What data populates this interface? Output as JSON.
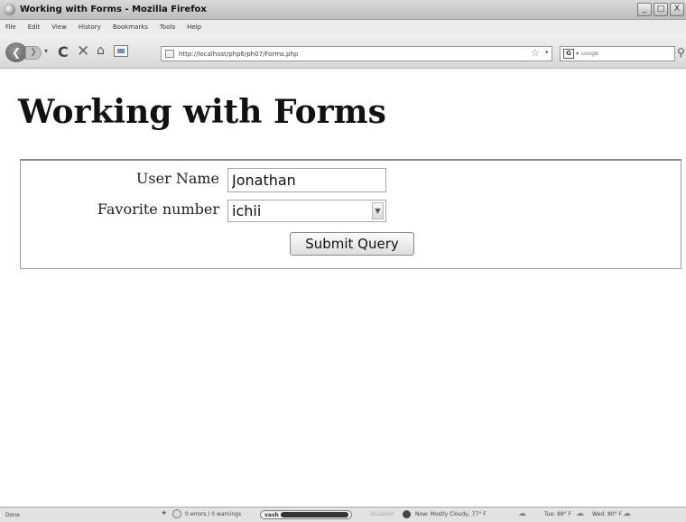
{
  "window": {
    "title": "Working with Forms - Mozilla Firefox",
    "controls": [
      "_",
      "□",
      "X"
    ]
  },
  "menu": [
    "File",
    "Edit",
    "View",
    "History",
    "Bookmarks",
    "Tools",
    "Help"
  ],
  "toolbar": {
    "back_glyph": "❮",
    "url": "http://localhost/php6/ph07/Forms.php",
    "search_engine": "G",
    "search_placeholder": "Google"
  },
  "page": {
    "heading": "Working with Forms",
    "form": {
      "username_label": "User Name",
      "username_value": "Jonathan",
      "number_label": "Favorite number",
      "number_selected": "ichii",
      "submit_label": "Submit Query"
    }
  },
  "status": {
    "text": "Done",
    "errors": "0 errors / 0 warnings",
    "vash": "vash",
    "disabled": "Disabled",
    "weather_now": "Now: Mostly Cloudy, 77° F",
    "weather_tue": "Tue: 88° F",
    "weather_wed": "Wed: 80° F"
  },
  "icons": {
    "back": "back-arrow-icon",
    "forward": "forward-arrow-icon",
    "reload": "reload-icon",
    "stop": "stop-icon",
    "home": "home-icon",
    "bookmark": "star-icon",
    "search": "magnifier-icon"
  }
}
